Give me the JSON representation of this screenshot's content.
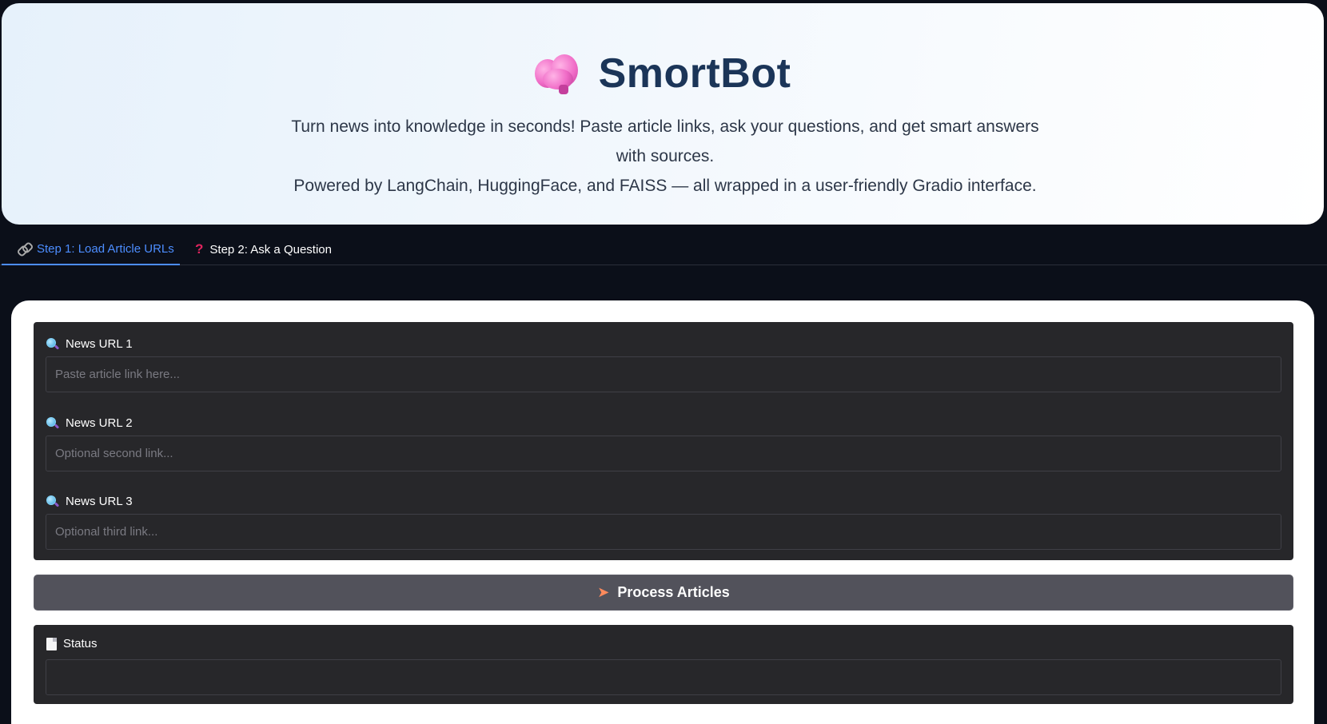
{
  "header": {
    "title": "SmortBot",
    "brand_icon": "brain-icon",
    "description_line1": "Turn news into knowledge in seconds! Paste article links, ask your questions, and get smart answers with sources.",
    "description_line2": "Powered by LangChain, HuggingFace, and FAISS — all wrapped in a user-friendly Gradio interface."
  },
  "tabs": [
    {
      "label": "Step 1: Load Article URLs",
      "icon": "link-icon",
      "active": true
    },
    {
      "label": "Step 2: Ask a Question",
      "icon": "question-mark-icon",
      "active": false
    }
  ],
  "inputs": {
    "url1": {
      "label": "News URL 1",
      "icon": "magnifying-glass-icon",
      "placeholder": "Paste article link here...",
      "value": ""
    },
    "url2": {
      "label": "News URL 2",
      "icon": "magnifying-glass-icon",
      "placeholder": "Optional second link...",
      "value": ""
    },
    "url3": {
      "label": "News URL 3",
      "icon": "magnifying-glass-icon",
      "placeholder": "Optional third link...",
      "value": ""
    }
  },
  "process_button": {
    "label": "Process Articles",
    "icon": "rocket-icon"
  },
  "status": {
    "label": "Status",
    "icon": "document-icon",
    "value": ""
  },
  "colors": {
    "background": "#0b0f19",
    "header_text": "#1b3558",
    "active_tab": "#4c8dff",
    "panel": "#27272a",
    "button": "#52525b"
  }
}
